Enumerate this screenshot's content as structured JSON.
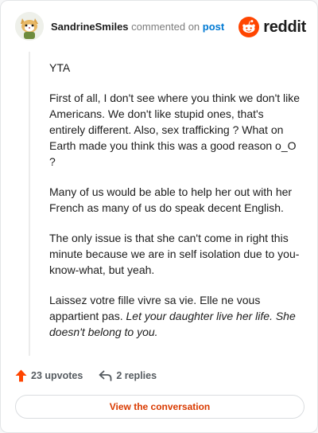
{
  "header": {
    "username": "SandrineSmiles",
    "action_text": "commented on",
    "post_link": "post",
    "brand_name": "reddit"
  },
  "comment": {
    "paragraphs": [
      "YTA",
      "First of all, I don't see where you think we don't like Americans. We don't like stupid ones, that's entirely different. Also, sex trafficking ? What on Earth made you think this was a good reason o_O ?",
      "Many of us would be able to help her out with her French as many of us do speak decent English.",
      "The only issue is that she can't come in right this minute because we are in self isolation due to you-know-what, but yeah."
    ],
    "last_paragraph_plain": "Laissez votre fille vivre sa vie. Elle ne vous appartient pas.",
    "last_paragraph_italic": "Let your daughter live her life. She doesn't belong to you."
  },
  "footer": {
    "upvotes": "23 upvotes",
    "replies": "2 replies",
    "cta_label": "View the conversation"
  },
  "colors": {
    "brand": "#ff4500",
    "link": "#0079d3",
    "cta_text": "#d93a00"
  }
}
